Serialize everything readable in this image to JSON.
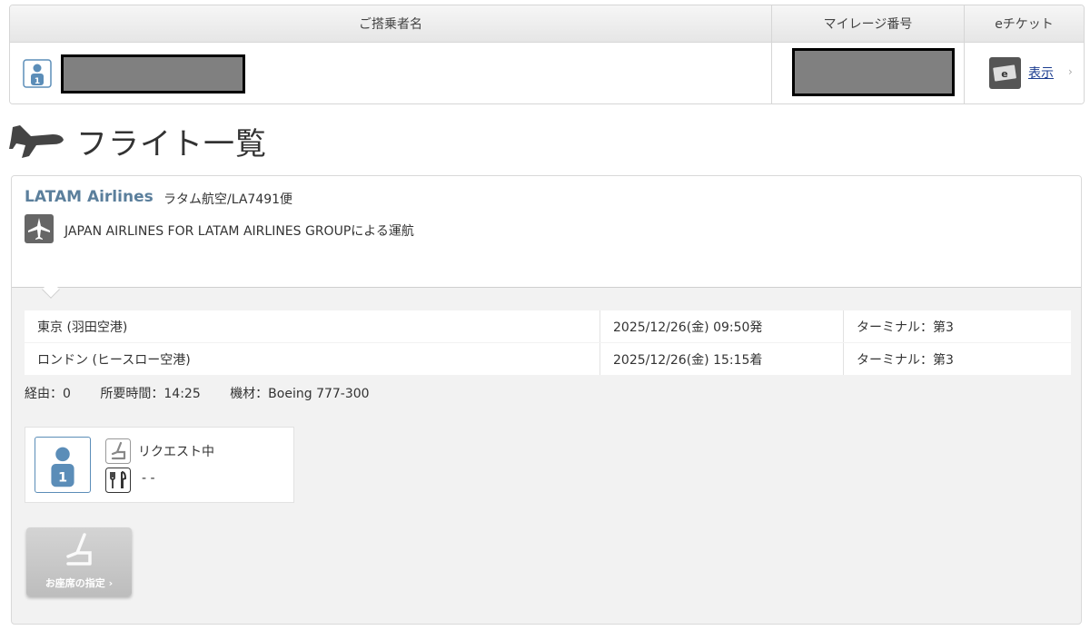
{
  "passengers_table": {
    "headers": {
      "name": "ご搭乗者名",
      "mileage": "マイレージ番号",
      "eticket": "eチケット"
    },
    "row": {
      "eticket_link": "表示",
      "eticket_chevron": "›"
    }
  },
  "section": {
    "title": "フライト一覧"
  },
  "flight": {
    "airline": "LATAM Airlines",
    "flight_number": "ラタム航空/LA7491便",
    "operated_by": "JAPAN AIRLINES FOR LATAM AIRLINES GROUPによる運航",
    "route": [
      {
        "city": "東京 (羽田空港)",
        "datetime": "2025/12/26(金) 09:50発",
        "terminal": "ターミナル：第3"
      },
      {
        "city": "ロンドン (ヒースロー空港)",
        "datetime": "2025/12/26(金) 15:15着",
        "terminal": "ターミナル：第3"
      }
    ],
    "info": {
      "stops": "経由：0",
      "duration": "所要時間：14:25",
      "aircraft": "機材：Boeing 777-300"
    },
    "passenger": {
      "number": "1",
      "seat_status": "リクエスト中",
      "meal_status": "- -"
    },
    "seat_button": "お座席の指定 ›"
  },
  "icons": {
    "passenger": "person-icon",
    "eticket": "eticket-icon",
    "title": "airplane-icon",
    "operator": "airplane-small-icon",
    "seat": "seat-icon",
    "meal": "meal-icon"
  },
  "colors": {
    "airline_name": "#5b7f9c",
    "link": "#1a3b8f",
    "passenger_blue": "#5b8db8"
  }
}
